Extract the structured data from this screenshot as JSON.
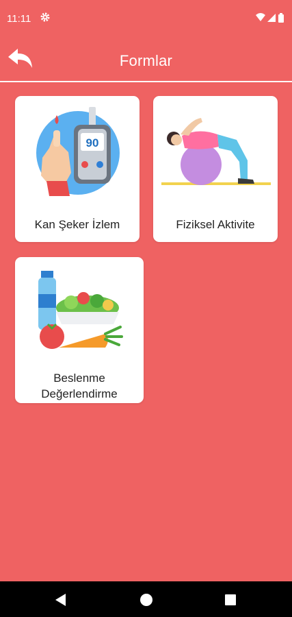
{
  "status_bar": {
    "time": "11:11",
    "icons": [
      "gear-icon",
      "wifi-icon",
      "signal-icon",
      "battery-icon"
    ]
  },
  "header": {
    "title": "Formlar",
    "back_icon": "reply-arrow-icon"
  },
  "colors": {
    "background": "#ef6262",
    "card": "#ffffff",
    "text": "#222222",
    "nav_bar": "#000000"
  },
  "forms": [
    {
      "label": "Kan Şeker İzlem",
      "icon": "glucose-meter-icon"
    },
    {
      "label": "Fiziksel Aktivite",
      "icon": "exercise-ball-icon"
    },
    {
      "label_line1": "Beslenme",
      "label_line2": "Değerlendirme",
      "icon": "vegetables-icon"
    }
  ],
  "nav": [
    "back-triangle-icon",
    "home-circle-icon",
    "recents-square-icon"
  ]
}
